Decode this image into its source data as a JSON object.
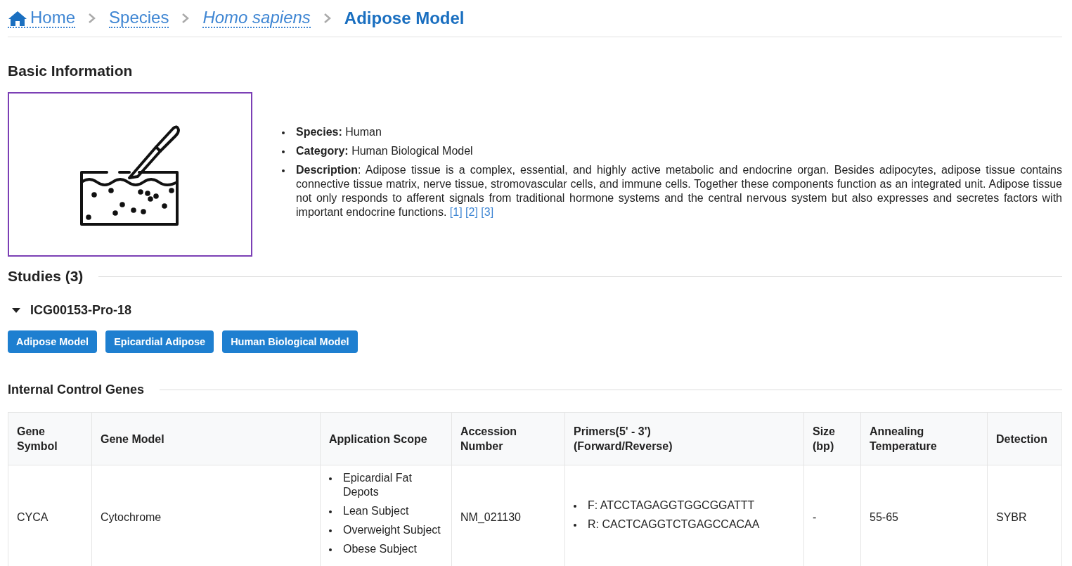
{
  "breadcrumb": [
    {
      "kind": "home",
      "label": "Home",
      "italic": false
    },
    {
      "kind": "link",
      "label": "Species",
      "italic": false
    },
    {
      "kind": "link",
      "label": "Homo sapiens",
      "italic": true
    },
    {
      "kind": "current",
      "label": "Adipose Model",
      "italic": false
    }
  ],
  "basic_information": {
    "title": "Basic Information",
    "facts": [
      {
        "text": "**Species:** Human"
      },
      {
        "text": "**Category:** Human Biological Model"
      },
      {
        "text": "**Description**: Adipose tissue is a complex, essential, and highly active metabolic and endocrine organ. Besides adipocytes, adipose tissue contains connective tissue matrix, nerve tissue, stromovascular cells, and immune cells. Together these components function as an integrated unit. Adipose tissue not only responds to afferent signals from traditional hormone systems and the central nervous system but also expresses and secretes factors with important endocrine functions.",
        "refs": [
          "[1]",
          "[2]",
          "[3]"
        ]
      }
    ]
  },
  "studies": {
    "title": "Studies (3)",
    "items": [
      {
        "id": "ICG00153-Pro-18",
        "expanded": true,
        "tags": [
          "Adipose Model",
          "Epicardial Adipose",
          "Human Biological Model"
        ],
        "internal_control_genes": {
          "title": "Internal Control Genes",
          "columns": [
            "Gene Symbol",
            "Gene Model",
            "Application Scope",
            "Accession Number",
            "Primers(5' - 3')\n(Forward/Reverse)",
            "Size (bp)",
            "Annealing Temperature",
            "Detection"
          ],
          "rows": [
            {
              "gene_symbol": "CYCA",
              "gene_model": "Cytochrome",
              "application_scope": [
                "Epicardial Fat Depots",
                "Lean Subject",
                "Overweight Subject",
                "Obese Subject"
              ],
              "accession_number": "NM_021130",
              "primers": [
                "F: ATCCTAGAGGTGGCGGATTT",
                "R: CACTCAGGTCTGAGCCACAA"
              ],
              "size": "-",
              "annealing_temperature": "55-65",
              "detection": "SYBR"
            }
          ]
        }
      }
    ]
  }
}
